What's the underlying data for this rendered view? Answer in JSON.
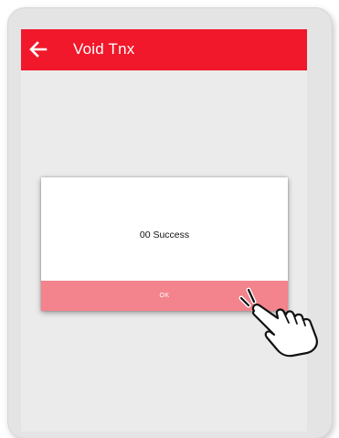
{
  "appbar": {
    "title": "Void Tnx",
    "back_icon": "arrow-left-icon",
    "color": "#f0182a"
  },
  "dialog": {
    "message": "00 Success",
    "ok_label": "OK",
    "ok_color": "#f3838c"
  },
  "overlay": {
    "icon": "pointing-hand-icon"
  }
}
